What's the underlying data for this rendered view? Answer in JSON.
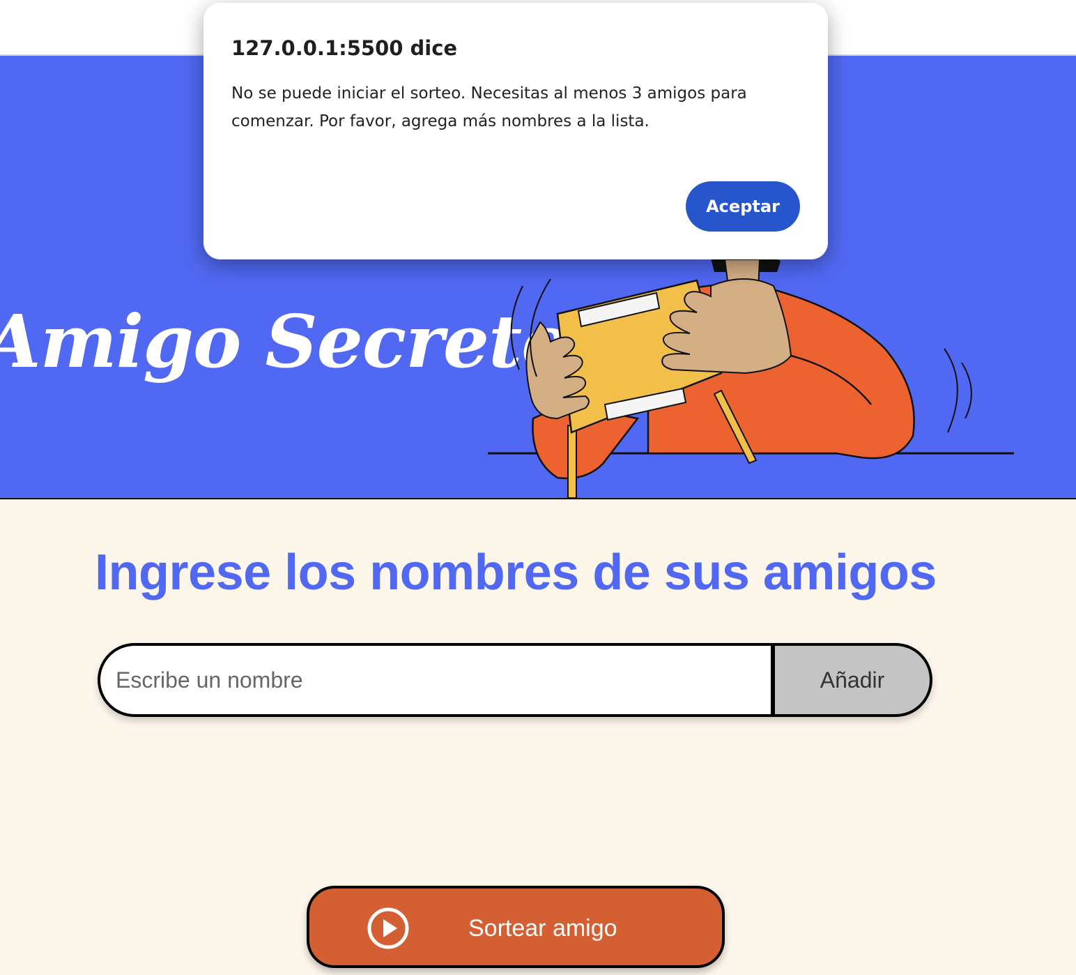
{
  "header": {
    "title": "Amigo Secreto"
  },
  "main": {
    "heading": "Ingrese los nombres de sus amigos",
    "name_input": {
      "placeholder": "Escribe un nombre",
      "value": ""
    },
    "add_button_label": "Añadir",
    "draw_button_label": "Sortear amigo"
  },
  "alert": {
    "title": "127.0.0.1:5500 dice",
    "message": "No se puede iniciar el sorteo. Necesitas al menos 3 amigos para comenzar. Por favor, agrega más nombres a la lista.",
    "ok_label": "Aceptar"
  },
  "icons": {
    "draw_button_icon": "play-circle-icon"
  },
  "colors": {
    "hero_background": "#5068f2",
    "page_background": "#fdf6eb",
    "heading": "#5068f2",
    "draw_button": "#d35f33",
    "add_button": "#c4c4c4",
    "alert_button": "#2756cc",
    "sweater": "#ec6331",
    "box": "#f2c04a",
    "skin": "#d4ae85"
  }
}
